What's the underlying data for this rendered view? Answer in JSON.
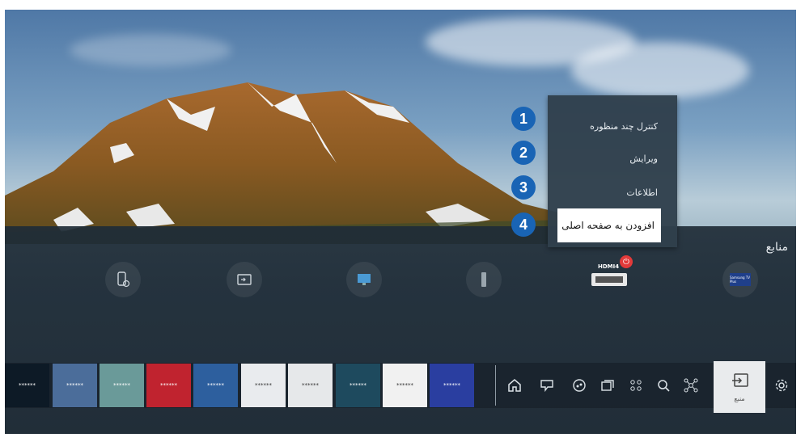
{
  "context_menu": {
    "items": [
      {
        "number": "1",
        "label": "کنترل چند منظوره"
      },
      {
        "number": "2",
        "label": "ویرایش"
      },
      {
        "number": "3",
        "label": "اطلاعات"
      },
      {
        "number": "4",
        "label": "افزودن به صفحه اصلی"
      }
    ]
  },
  "sources": {
    "title": "منابع",
    "hdmi_label": "HDMI4",
    "samsung_tag_label": "Samsung TV Plus"
  },
  "app_bar": {
    "tiles": [
      "******",
      "******",
      "******",
      "******",
      "******",
      "******",
      "******",
      "******",
      "******",
      "******"
    ],
    "tile_colors": [
      "#0d1a26",
      "#4b6d9a",
      "#6a9a99",
      "#c0232f",
      "#2d5f9e",
      "#e9ebee",
      "#e6e8ea",
      "#1e4a5e",
      "#f1f1f1",
      "#2a3ea0"
    ],
    "source_button_label": "منبع"
  },
  "accent_colors": {
    "number_badge": "#1964b5",
    "power": "#e23a3a"
  }
}
